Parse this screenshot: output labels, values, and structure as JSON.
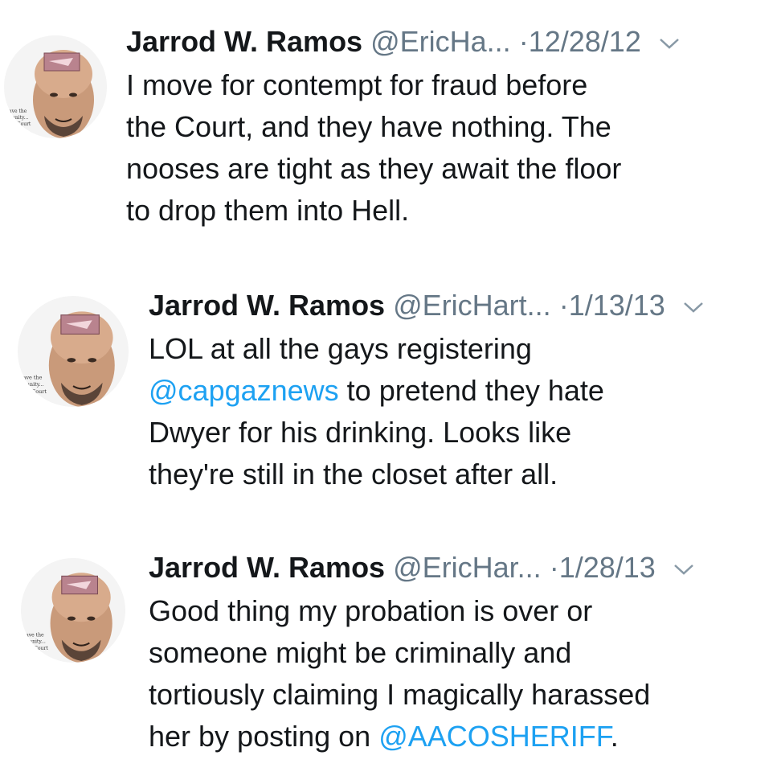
{
  "tweets": [
    {
      "name": "Jarrod W. Ramos",
      "handle": "@EricHa...",
      "separator": "·",
      "date": "12/28/12",
      "lines": [
        "I move for contempt for fraud before",
        "the Court, and they have nothing. The",
        "nooses are tight as they await the floor",
        "to drop them into Hell."
      ]
    },
    {
      "name": "Jarrod W. Ramos",
      "handle": "@EricHart...",
      "separator": "·",
      "date": "1/13/13",
      "line1": "LOL at all the gays registering",
      "mention": "@capgaznews",
      "line2_rest": " to pretend they hate",
      "line3": "Dwyer for his drinking. Looks like",
      "line4": "they're still in the closet after all."
    },
    {
      "name": "Jarrod W. Ramos",
      "handle": "@EricHar...",
      "separator": "·",
      "date": "1/28/13",
      "line1": "Good thing my probation is over or",
      "line2": "someone might be criminally and",
      "line3": "tortiously claiming I magically harassed",
      "line4_pre": "her by posting on ",
      "mention": "@AACOSHERIFF",
      "line4_post": "."
    }
  ],
  "avatar_caption_lines": [
    "ave the",
    "unity...",
    "Court"
  ],
  "colors": {
    "text": "#14171a",
    "secondary": "#657786",
    "link": "#1da1f2"
  },
  "icons": {
    "caret": "chevron-down-icon",
    "avatar": "avatar"
  }
}
